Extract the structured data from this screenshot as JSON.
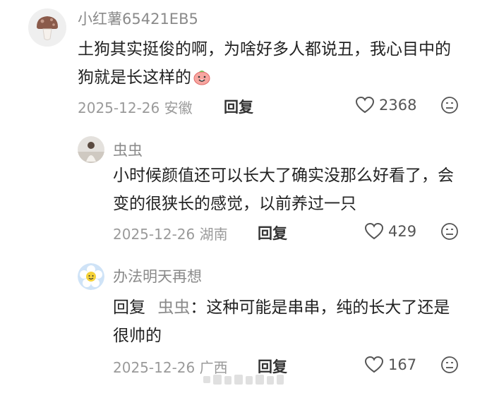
{
  "comments": [
    {
      "username": "小红薯65421EB5",
      "text": "土狗其实挺俊的啊，为啥好多人都说丑，我心目中的狗就是长这样的",
      "emoji": "peach-face-emoji",
      "date": "2025-12-26",
      "location": "安徽",
      "reply_label": "回复",
      "likes": "2368"
    },
    {
      "username": "虫虫",
      "text": "小时候颜值还可以长大了确实没那么好看了，会变的很狭长的感觉，以前养过一只",
      "date": "2025-12-26",
      "location": "湖南",
      "reply_label": "回复",
      "likes": "429"
    },
    {
      "username": "办法明天再想",
      "reply_prefix": "回复",
      "reply_to": "虫虫",
      "reply_colon": "：",
      "text": "这种可能是串串，纯的长大了还是很帅的",
      "date": "2025-12-26",
      "location": "广西",
      "reply_label": "回复",
      "likes": "167"
    }
  ],
  "colors": {
    "meta": "#9a9a9a",
    "username": "#8a8a8a",
    "text": "#222222"
  },
  "icons": [
    "heart-outline-icon",
    "dislike-face-icon"
  ]
}
